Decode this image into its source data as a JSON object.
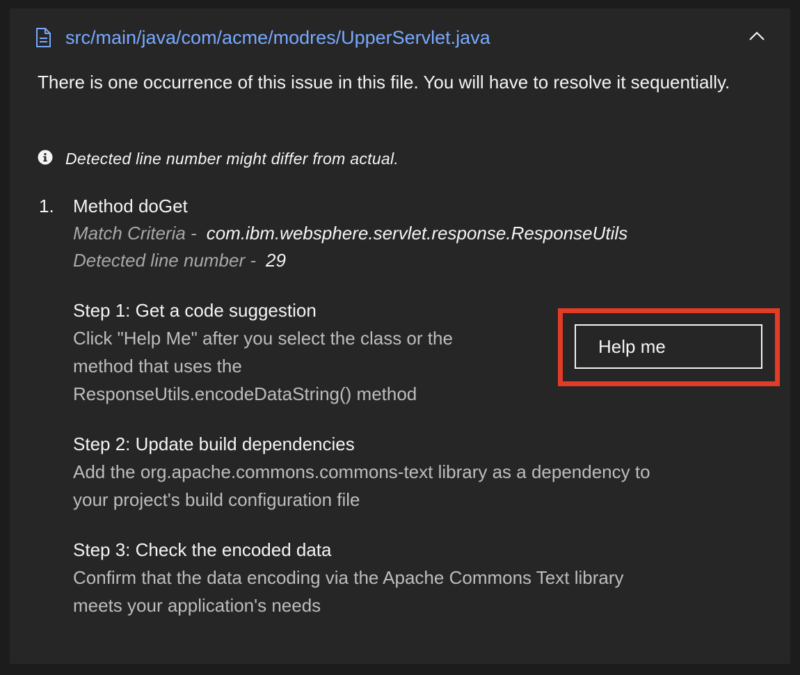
{
  "file": {
    "path": "src/main/java/com/acme/modres/UpperServlet.java",
    "file_icon": "document-icon",
    "collapse_icon": "chevron-up-icon",
    "link_color": "#78a9ff"
  },
  "intro": "There is one occurrence of this issue in this file. You will have to resolve it sequentially.",
  "notice": {
    "icon": "info-icon",
    "text": "Detected line number might differ from actual."
  },
  "occurrence": {
    "number": "1.",
    "title": "Method doGet",
    "match_criteria_label": "Match Criteria -",
    "match_criteria_value": "com.ibm.websphere.servlet.response.ResponseUtils",
    "line_label": "Detected line number -",
    "line_value": "29"
  },
  "steps": [
    {
      "title": "Step 1: Get a code suggestion",
      "description_lines": [
        "Click \"Help Me\" after you select the class or the",
        "method that uses the",
        "ResponseUtils.encodeDataString() method"
      ]
    },
    {
      "title": "Step 2: Update build dependencies",
      "description_lines": [
        "Add the org.apache.commons.commons-text library as a dependency to",
        "your project's build configuration file"
      ]
    },
    {
      "title": "Step 3: Check the encoded data",
      "description_lines": [
        "Confirm that the data encoding via the Apache Commons Text library",
        "meets your application's needs"
      ]
    }
  ],
  "help_button": {
    "label": "Help me",
    "highlight_color": "#e33b25"
  }
}
